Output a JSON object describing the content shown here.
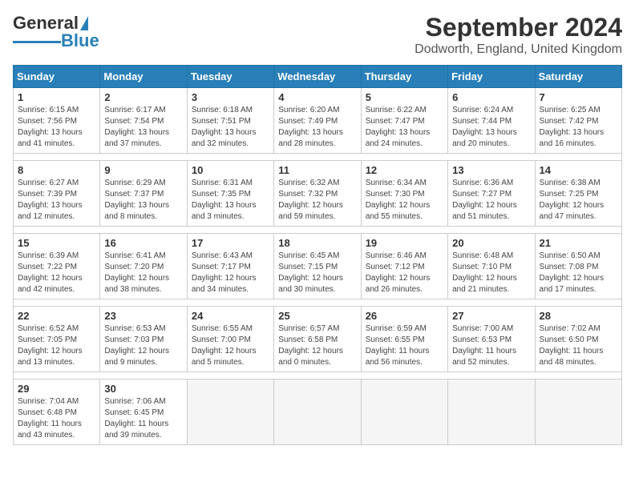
{
  "header": {
    "logo_general": "General",
    "logo_blue": "Blue",
    "title": "September 2024",
    "subtitle": "Dodworth, England, United Kingdom"
  },
  "days_of_week": [
    "Sunday",
    "Monday",
    "Tuesday",
    "Wednesday",
    "Thursday",
    "Friday",
    "Saturday"
  ],
  "weeks": [
    [
      {
        "date": "1",
        "sunrise": "6:15 AM",
        "sunset": "7:56 PM",
        "daylight": "13 hours and 41 minutes."
      },
      {
        "date": "2",
        "sunrise": "6:17 AM",
        "sunset": "7:54 PM",
        "daylight": "13 hours and 37 minutes."
      },
      {
        "date": "3",
        "sunrise": "6:18 AM",
        "sunset": "7:51 PM",
        "daylight": "13 hours and 32 minutes."
      },
      {
        "date": "4",
        "sunrise": "6:20 AM",
        "sunset": "7:49 PM",
        "daylight": "13 hours and 28 minutes."
      },
      {
        "date": "5",
        "sunrise": "6:22 AM",
        "sunset": "7:47 PM",
        "daylight": "13 hours and 24 minutes."
      },
      {
        "date": "6",
        "sunrise": "6:24 AM",
        "sunset": "7:44 PM",
        "daylight": "13 hours and 20 minutes."
      },
      {
        "date": "7",
        "sunrise": "6:25 AM",
        "sunset": "7:42 PM",
        "daylight": "13 hours and 16 minutes."
      }
    ],
    [
      {
        "date": "8",
        "sunrise": "6:27 AM",
        "sunset": "7:39 PM",
        "daylight": "13 hours and 12 minutes."
      },
      {
        "date": "9",
        "sunrise": "6:29 AM",
        "sunset": "7:37 PM",
        "daylight": "13 hours and 8 minutes."
      },
      {
        "date": "10",
        "sunrise": "6:31 AM",
        "sunset": "7:35 PM",
        "daylight": "13 hours and 3 minutes."
      },
      {
        "date": "11",
        "sunrise": "6:32 AM",
        "sunset": "7:32 PM",
        "daylight": "12 hours and 59 minutes."
      },
      {
        "date": "12",
        "sunrise": "6:34 AM",
        "sunset": "7:30 PM",
        "daylight": "12 hours and 55 minutes."
      },
      {
        "date": "13",
        "sunrise": "6:36 AM",
        "sunset": "7:27 PM",
        "daylight": "12 hours and 51 minutes."
      },
      {
        "date": "14",
        "sunrise": "6:38 AM",
        "sunset": "7:25 PM",
        "daylight": "12 hours and 47 minutes."
      }
    ],
    [
      {
        "date": "15",
        "sunrise": "6:39 AM",
        "sunset": "7:22 PM",
        "daylight": "12 hours and 42 minutes."
      },
      {
        "date": "16",
        "sunrise": "6:41 AM",
        "sunset": "7:20 PM",
        "daylight": "12 hours and 38 minutes."
      },
      {
        "date": "17",
        "sunrise": "6:43 AM",
        "sunset": "7:17 PM",
        "daylight": "12 hours and 34 minutes."
      },
      {
        "date": "18",
        "sunrise": "6:45 AM",
        "sunset": "7:15 PM",
        "daylight": "12 hours and 30 minutes."
      },
      {
        "date": "19",
        "sunrise": "6:46 AM",
        "sunset": "7:12 PM",
        "daylight": "12 hours and 26 minutes."
      },
      {
        "date": "20",
        "sunrise": "6:48 AM",
        "sunset": "7:10 PM",
        "daylight": "12 hours and 21 minutes."
      },
      {
        "date": "21",
        "sunrise": "6:50 AM",
        "sunset": "7:08 PM",
        "daylight": "12 hours and 17 minutes."
      }
    ],
    [
      {
        "date": "22",
        "sunrise": "6:52 AM",
        "sunset": "7:05 PM",
        "daylight": "12 hours and 13 minutes."
      },
      {
        "date": "23",
        "sunrise": "6:53 AM",
        "sunset": "7:03 PM",
        "daylight": "12 hours and 9 minutes."
      },
      {
        "date": "24",
        "sunrise": "6:55 AM",
        "sunset": "7:00 PM",
        "daylight": "12 hours and 5 minutes."
      },
      {
        "date": "25",
        "sunrise": "6:57 AM",
        "sunset": "6:58 PM",
        "daylight": "12 hours and 0 minutes."
      },
      {
        "date": "26",
        "sunrise": "6:59 AM",
        "sunset": "6:55 PM",
        "daylight": "11 hours and 56 minutes."
      },
      {
        "date": "27",
        "sunrise": "7:00 AM",
        "sunset": "6:53 PM",
        "daylight": "11 hours and 52 minutes."
      },
      {
        "date": "28",
        "sunrise": "7:02 AM",
        "sunset": "6:50 PM",
        "daylight": "11 hours and 48 minutes."
      }
    ],
    [
      {
        "date": "29",
        "sunrise": "7:04 AM",
        "sunset": "6:48 PM",
        "daylight": "11 hours and 43 minutes."
      },
      {
        "date": "30",
        "sunrise": "7:06 AM",
        "sunset": "6:45 PM",
        "daylight": "11 hours and 39 minutes."
      },
      null,
      null,
      null,
      null,
      null
    ]
  ]
}
